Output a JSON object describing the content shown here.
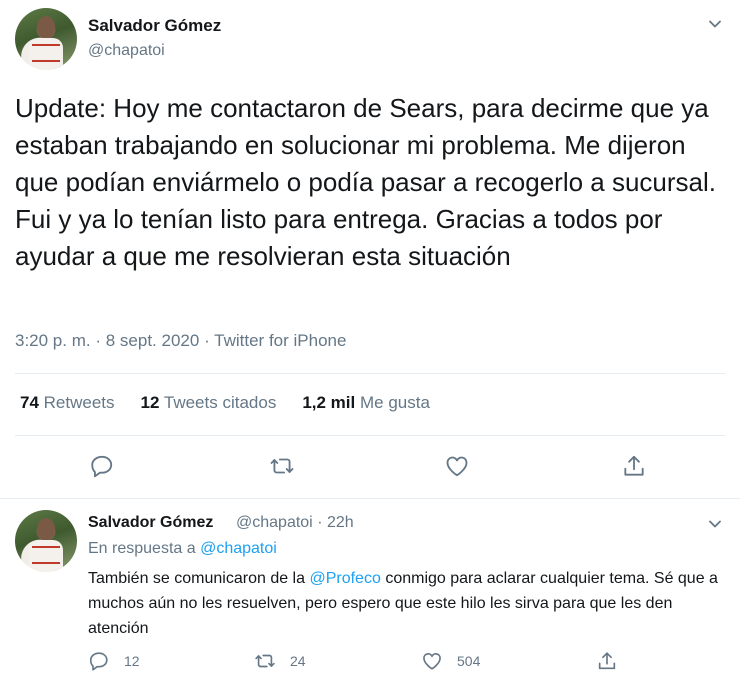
{
  "main_tweet": {
    "author_name": "Salvador Gómez",
    "author_handle": "@chapatoi",
    "text": "Update: Hoy me contactaron de Sears, para decirme que ya estaban trabajando en solucionar mi problema. Me dijeron que podían enviármelo o podía pasar a recogerlo a sucursal. Fui y ya lo tenían listo para entrega. Gracias a todos por ayudar a que me resolvieran esta situación",
    "time": "3:20 p. m.",
    "separator": "·",
    "date": "8 sept. 2020",
    "source": "Twitter for iPhone",
    "stats": {
      "retweets_count": "74",
      "retweets_label": "Retweets",
      "quotes_count": "12",
      "quotes_label": "Tweets citados",
      "likes_count": "1,2 mil",
      "likes_label": "Me gusta"
    }
  },
  "reply_tweet": {
    "author_name": "Salvador Gómez",
    "author_handle": "@chapatoi",
    "separator": "·",
    "age": "22h",
    "in_reply_prefix": "En respuesta a",
    "in_reply_handle": "@chapatoi",
    "text_before_mention": "También se comunicaron de la",
    "mention": "@Profeco",
    "text_after_mention": "conmigo para aclarar cualquier tema. Sé que a muchos aún no les resuelven, pero espero que este hilo les sirva para que les den atención",
    "reply_count": "12",
    "retweet_count": "24",
    "like_count": "504"
  },
  "icons": {
    "caret": "chevron-down-icon",
    "reply": "reply-icon",
    "retweet": "retweet-icon",
    "like": "heart-icon",
    "share": "share-icon"
  },
  "colors": {
    "text": "#14171a",
    "secondary": "#657786",
    "link": "#1da1f2",
    "divider": "#e6ecf0"
  }
}
